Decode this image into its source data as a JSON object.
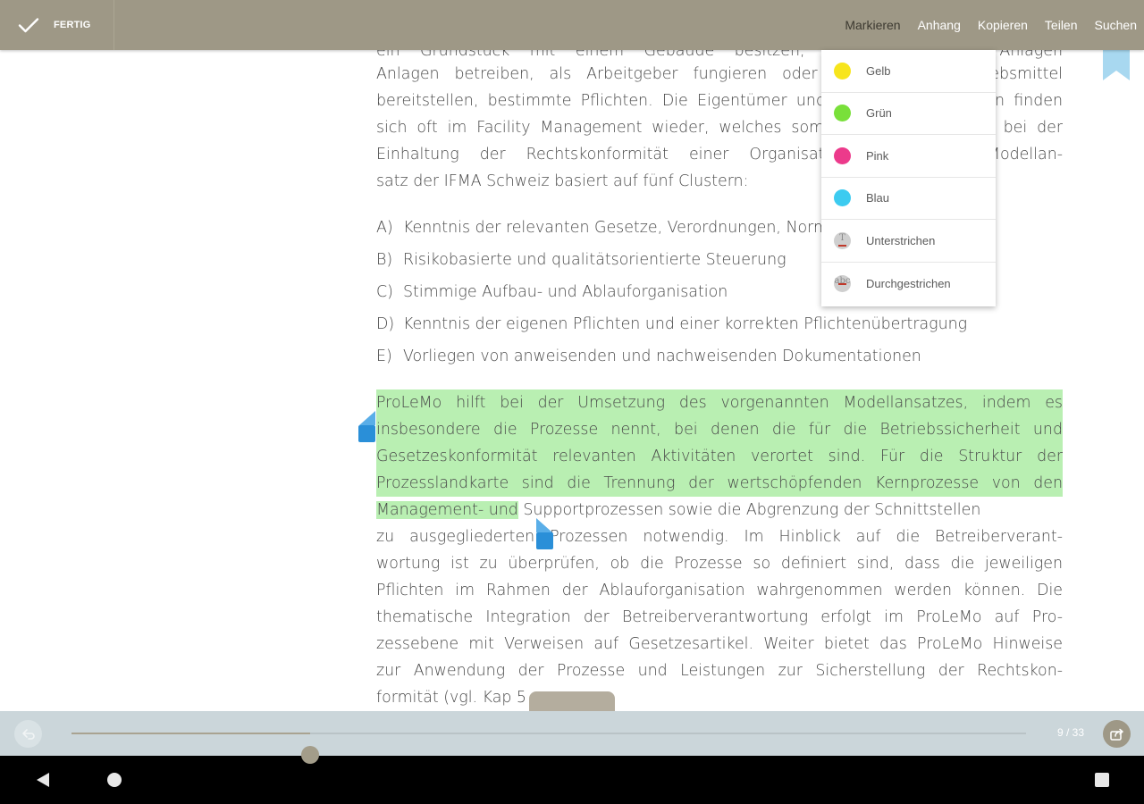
{
  "toolbar": {
    "done_label": "FERTIG",
    "actions": [
      "Markieren",
      "Anhang",
      "Kopieren",
      "Teilen",
      "Suchen"
    ],
    "active_action": "Markieren"
  },
  "document": {
    "intro_lines": [
      "ein Grundstück mit einem Gebäude besitzen, Gebäudetechnische Anlagen",
      "Anlagen betreiben, als Arbeitgeber fungieren oder Arbeits- und Betriebsmittel",
      "bereitstellen, bestimmte Pflichten. Die Eigentümer und Betreiber von diesen finden",
      "sich oft im Facility Management wieder, welches somit eine Schlüsselrolle bei der",
      "Einhaltung der Rechtskonformität einer Organisation spielt. Das Modellan-",
      "satz der IFMA Schweiz basiert auf fünf Clustern:"
    ],
    "list_items": [
      {
        "mark": "A)",
        "text": "Kenntnis der relevanten Gesetze, Verordnungen, Normen und Richtlinien"
      },
      {
        "mark": "B)",
        "text": "Risikobasierte und qualitätsorientierte Steuerung"
      },
      {
        "mark": "C)",
        "text": "Stimmige Aufbau- und Ablauforganisation"
      },
      {
        "mark": "D)",
        "text": "Kenntnis der eigenen Pflichten und einer korrekten Pflichtenübertragung"
      },
      {
        "mark": "E)",
        "text": "Vorliegen von anweisenden und nachweisenden Dokumentationen"
      }
    ],
    "highlighted_lines": [
      "ProLeMo hilft bei der Umsetzung des vorgenannten Modellansatzes, indem es",
      "insbesondere die Prozesse nennt, bei denen die für die Betriebssicherheit und",
      "Gesetzeskonformität relevanten Aktivitäten verortet sind. Für die Struktur der",
      "Prozesslandkarte sind die Trennung der wertschöpfenden Kernprozesse von den"
    ],
    "partial_highlight": "Management- und",
    "partial_rest": "Supportprozessen sowie die Abgrenzung der Schnittstellen",
    "rest_lines": [
      "zu ausgegliederten Prozessen notwendig. Im Hinblick auf die Betreiberverant-",
      "wortung ist zu überprüfen, ob die Prozesse so definiert sind, dass die jeweiligen",
      "Pflichten im Rahmen der Ablauforganisation wahrgenommen werden können. Die",
      "thematische Integration der Betreiberverantwortung erfolgt im ProLeMo auf Pro-",
      "zessebene mit Verweisen auf Gesetzesartikel. Weiter bietet das ProLeMo Hinweise",
      "zur Anwendung der Prozesse und Leistungen zur Sicherstellung der Rechtskon-"
    ],
    "last_line": "formität (vgl. Kap 5"
  },
  "highlight_menu": {
    "items": [
      {
        "label": "Gelb",
        "icon": "yellow-dot-icon",
        "color": "#f7e51c"
      },
      {
        "label": "Grün",
        "icon": "green-dot-icon",
        "color": "#79e03a"
      },
      {
        "label": "Pink",
        "icon": "pink-dot-icon",
        "color": "#ec3a8b"
      },
      {
        "label": "Blau",
        "icon": "blue-dot-icon",
        "color": "#3ccbf0"
      },
      {
        "label": "Unterstrichen",
        "icon": "underline-icon"
      },
      {
        "label": "Durchgestrichen",
        "icon": "strikethrough-icon"
      }
    ]
  },
  "slider": {
    "progress": 0.25,
    "page_count": "9 / 33"
  },
  "colors": {
    "toolbar_bg": "#9e9886",
    "highlight_green": "#b9efb2",
    "bookmark": "#a8d8f0",
    "selection_handle": "#2a8fd8"
  }
}
